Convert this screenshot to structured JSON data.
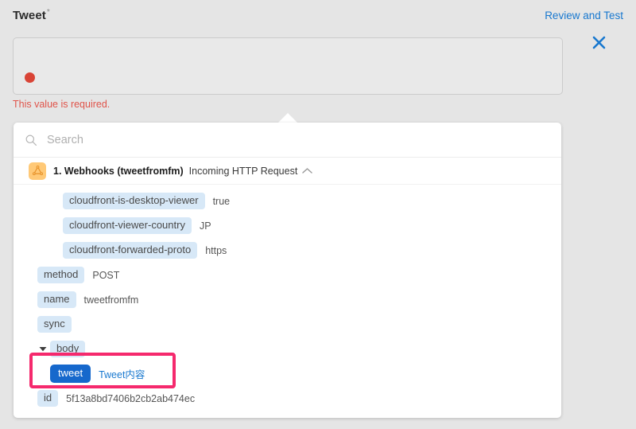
{
  "form": {
    "field_label": "Tweet",
    "required_marker": "*",
    "review_and_test": "Review and Test",
    "close_icon": "close-icon",
    "validation_message": "This value is required.",
    "input_value": "",
    "token_color": "#d94436"
  },
  "picker": {
    "search": {
      "placeholder": "Search",
      "value": "",
      "icon": "search-icon"
    },
    "group": {
      "icon": "webhooks-icon",
      "title": "1. Webhooks (tweetfromfm)",
      "subtitle": "Incoming HTTP Request",
      "collapse_icon": "chevron-up-icon"
    },
    "items": [
      {
        "name": "cloudfront-is-desktop-viewer",
        "value": "true",
        "indent": 2,
        "expandable": false,
        "selected": false
      },
      {
        "name": "cloudfront-viewer-country",
        "value": "JP",
        "indent": 2,
        "expandable": false,
        "selected": false
      },
      {
        "name": "cloudfront-forwarded-proto",
        "value": "https",
        "indent": 2,
        "expandable": false,
        "selected": false
      },
      {
        "name": "method",
        "value": "POST",
        "indent": 0,
        "expandable": false,
        "selected": false
      },
      {
        "name": "name",
        "value": "tweetfromfm",
        "indent": 0,
        "expandable": false,
        "selected": false
      },
      {
        "name": "sync",
        "value": "",
        "indent": 0,
        "expandable": false,
        "selected": false
      },
      {
        "name": "body",
        "value": "",
        "indent": 0,
        "expandable": true,
        "selected": false
      },
      {
        "name": "tweet",
        "value": "Tweet内容",
        "indent": 1,
        "expandable": false,
        "selected": true
      },
      {
        "name": "id",
        "value": "5f13a8bd7406b2cb2ab474ec",
        "indent": 0,
        "expandable": false,
        "selected": false
      }
    ]
  },
  "colors": {
    "accent_blue": "#1878cf",
    "selected_chip": "#1668cc",
    "chip_bg": "#d7e8f7",
    "highlight_pink": "#f5296d",
    "error_red": "#e0544a",
    "webhook_orange": "#ffc977"
  }
}
